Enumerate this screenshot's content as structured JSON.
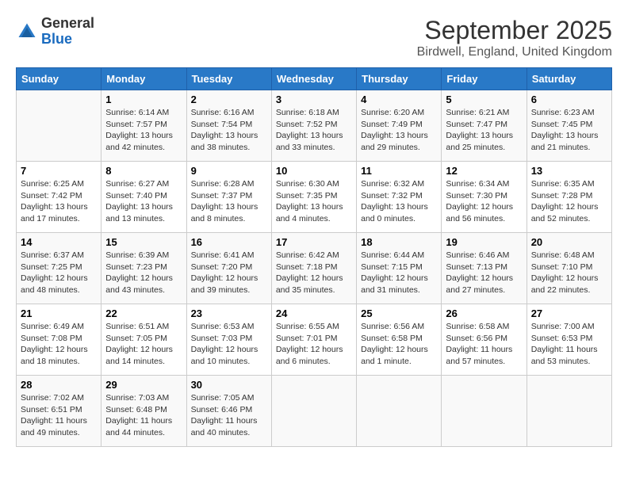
{
  "header": {
    "logo_general": "General",
    "logo_blue": "Blue",
    "title": "September 2025",
    "location": "Birdwell, England, United Kingdom"
  },
  "days_of_week": [
    "Sunday",
    "Monday",
    "Tuesday",
    "Wednesday",
    "Thursday",
    "Friday",
    "Saturday"
  ],
  "weeks": [
    [
      {
        "day": "",
        "sunrise": "",
        "sunset": "",
        "daylight": ""
      },
      {
        "day": "1",
        "sunrise": "Sunrise: 6:14 AM",
        "sunset": "Sunset: 7:57 PM",
        "daylight": "Daylight: 13 hours and 42 minutes."
      },
      {
        "day": "2",
        "sunrise": "Sunrise: 6:16 AM",
        "sunset": "Sunset: 7:54 PM",
        "daylight": "Daylight: 13 hours and 38 minutes."
      },
      {
        "day": "3",
        "sunrise": "Sunrise: 6:18 AM",
        "sunset": "Sunset: 7:52 PM",
        "daylight": "Daylight: 13 hours and 33 minutes."
      },
      {
        "day": "4",
        "sunrise": "Sunrise: 6:20 AM",
        "sunset": "Sunset: 7:49 PM",
        "daylight": "Daylight: 13 hours and 29 minutes."
      },
      {
        "day": "5",
        "sunrise": "Sunrise: 6:21 AM",
        "sunset": "Sunset: 7:47 PM",
        "daylight": "Daylight: 13 hours and 25 minutes."
      },
      {
        "day": "6",
        "sunrise": "Sunrise: 6:23 AM",
        "sunset": "Sunset: 7:45 PM",
        "daylight": "Daylight: 13 hours and 21 minutes."
      }
    ],
    [
      {
        "day": "7",
        "sunrise": "Sunrise: 6:25 AM",
        "sunset": "Sunset: 7:42 PM",
        "daylight": "Daylight: 13 hours and 17 minutes."
      },
      {
        "day": "8",
        "sunrise": "Sunrise: 6:27 AM",
        "sunset": "Sunset: 7:40 PM",
        "daylight": "Daylight: 13 hours and 13 minutes."
      },
      {
        "day": "9",
        "sunrise": "Sunrise: 6:28 AM",
        "sunset": "Sunset: 7:37 PM",
        "daylight": "Daylight: 13 hours and 8 minutes."
      },
      {
        "day": "10",
        "sunrise": "Sunrise: 6:30 AM",
        "sunset": "Sunset: 7:35 PM",
        "daylight": "Daylight: 13 hours and 4 minutes."
      },
      {
        "day": "11",
        "sunrise": "Sunrise: 6:32 AM",
        "sunset": "Sunset: 7:32 PM",
        "daylight": "Daylight: 13 hours and 0 minutes."
      },
      {
        "day": "12",
        "sunrise": "Sunrise: 6:34 AM",
        "sunset": "Sunset: 7:30 PM",
        "daylight": "Daylight: 12 hours and 56 minutes."
      },
      {
        "day": "13",
        "sunrise": "Sunrise: 6:35 AM",
        "sunset": "Sunset: 7:28 PM",
        "daylight": "Daylight: 12 hours and 52 minutes."
      }
    ],
    [
      {
        "day": "14",
        "sunrise": "Sunrise: 6:37 AM",
        "sunset": "Sunset: 7:25 PM",
        "daylight": "Daylight: 12 hours and 48 minutes."
      },
      {
        "day": "15",
        "sunrise": "Sunrise: 6:39 AM",
        "sunset": "Sunset: 7:23 PM",
        "daylight": "Daylight: 12 hours and 43 minutes."
      },
      {
        "day": "16",
        "sunrise": "Sunrise: 6:41 AM",
        "sunset": "Sunset: 7:20 PM",
        "daylight": "Daylight: 12 hours and 39 minutes."
      },
      {
        "day": "17",
        "sunrise": "Sunrise: 6:42 AM",
        "sunset": "Sunset: 7:18 PM",
        "daylight": "Daylight: 12 hours and 35 minutes."
      },
      {
        "day": "18",
        "sunrise": "Sunrise: 6:44 AM",
        "sunset": "Sunset: 7:15 PM",
        "daylight": "Daylight: 12 hours and 31 minutes."
      },
      {
        "day": "19",
        "sunrise": "Sunrise: 6:46 AM",
        "sunset": "Sunset: 7:13 PM",
        "daylight": "Daylight: 12 hours and 27 minutes."
      },
      {
        "day": "20",
        "sunrise": "Sunrise: 6:48 AM",
        "sunset": "Sunset: 7:10 PM",
        "daylight": "Daylight: 12 hours and 22 minutes."
      }
    ],
    [
      {
        "day": "21",
        "sunrise": "Sunrise: 6:49 AM",
        "sunset": "Sunset: 7:08 PM",
        "daylight": "Daylight: 12 hours and 18 minutes."
      },
      {
        "day": "22",
        "sunrise": "Sunrise: 6:51 AM",
        "sunset": "Sunset: 7:05 PM",
        "daylight": "Daylight: 12 hours and 14 minutes."
      },
      {
        "day": "23",
        "sunrise": "Sunrise: 6:53 AM",
        "sunset": "Sunset: 7:03 PM",
        "daylight": "Daylight: 12 hours and 10 minutes."
      },
      {
        "day": "24",
        "sunrise": "Sunrise: 6:55 AM",
        "sunset": "Sunset: 7:01 PM",
        "daylight": "Daylight: 12 hours and 6 minutes."
      },
      {
        "day": "25",
        "sunrise": "Sunrise: 6:56 AM",
        "sunset": "Sunset: 6:58 PM",
        "daylight": "Daylight: 12 hours and 1 minute."
      },
      {
        "day": "26",
        "sunrise": "Sunrise: 6:58 AM",
        "sunset": "Sunset: 6:56 PM",
        "daylight": "Daylight: 11 hours and 57 minutes."
      },
      {
        "day": "27",
        "sunrise": "Sunrise: 7:00 AM",
        "sunset": "Sunset: 6:53 PM",
        "daylight": "Daylight: 11 hours and 53 minutes."
      }
    ],
    [
      {
        "day": "28",
        "sunrise": "Sunrise: 7:02 AM",
        "sunset": "Sunset: 6:51 PM",
        "daylight": "Daylight: 11 hours and 49 minutes."
      },
      {
        "day": "29",
        "sunrise": "Sunrise: 7:03 AM",
        "sunset": "Sunset: 6:48 PM",
        "daylight": "Daylight: 11 hours and 44 minutes."
      },
      {
        "day": "30",
        "sunrise": "Sunrise: 7:05 AM",
        "sunset": "Sunset: 6:46 PM",
        "daylight": "Daylight: 11 hours and 40 minutes."
      },
      {
        "day": "",
        "sunrise": "",
        "sunset": "",
        "daylight": ""
      },
      {
        "day": "",
        "sunrise": "",
        "sunset": "",
        "daylight": ""
      },
      {
        "day": "",
        "sunrise": "",
        "sunset": "",
        "daylight": ""
      },
      {
        "day": "",
        "sunrise": "",
        "sunset": "",
        "daylight": ""
      }
    ]
  ]
}
